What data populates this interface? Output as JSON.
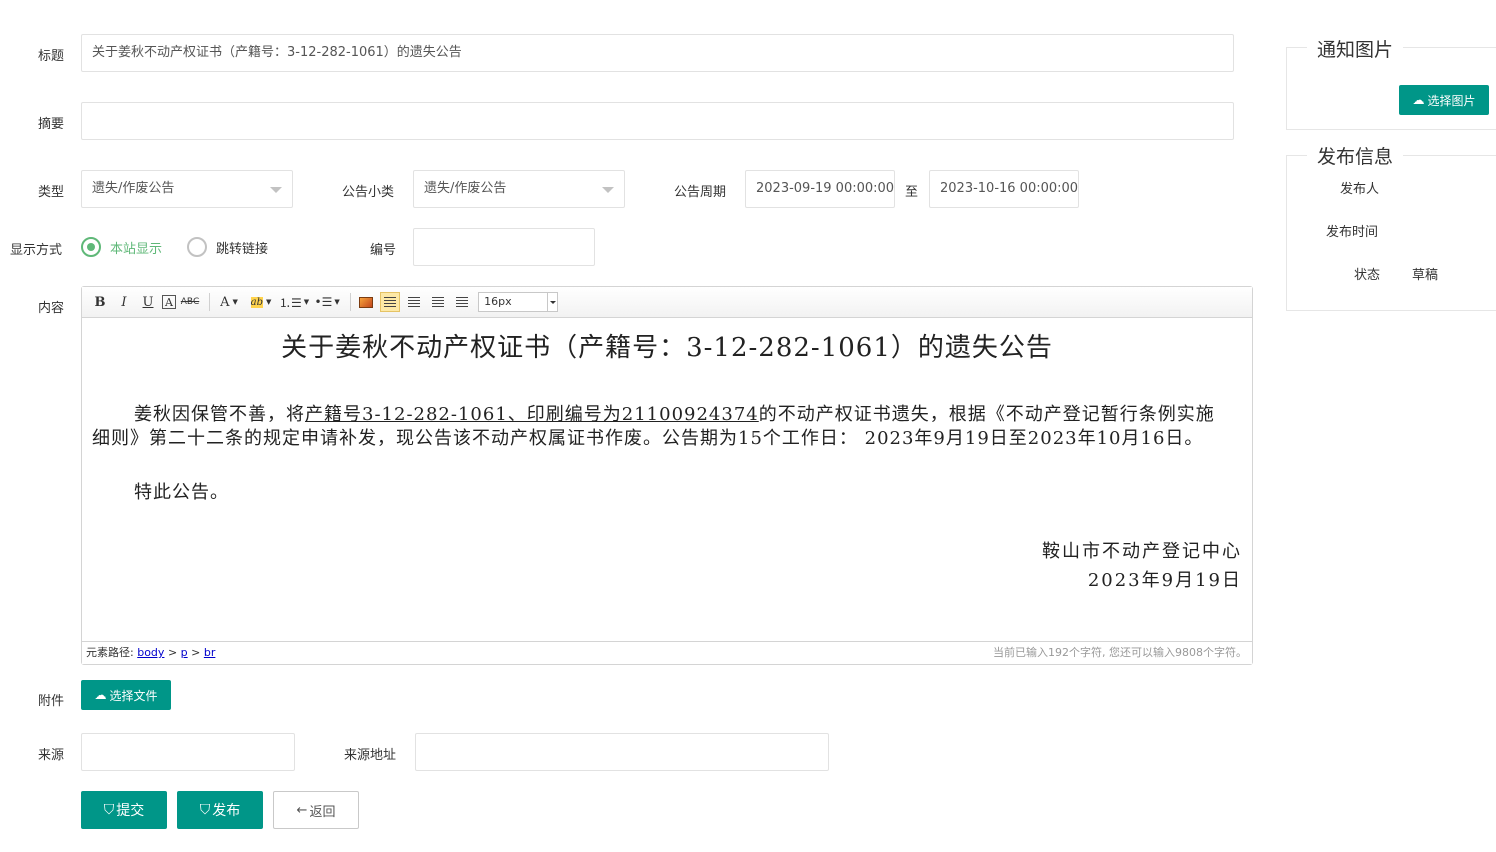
{
  "form": {
    "title_label": "标题",
    "title_value": "关于姜秋不动产权证书（产籍号：3-12-282-1061）的遗失公告",
    "summary_label": "摘要",
    "summary_value": "",
    "type_label": "类型",
    "type_value": "遗失/作废公告",
    "subtype_label": "公告小类",
    "subtype_value": "遗失/作废公告",
    "period_label": "公告周期",
    "period_start": "2023-09-19 00:00:00",
    "period_to": "至",
    "period_end": "2023-10-16 00:00:00",
    "display_label": "显示方式",
    "display_options": [
      "本站显示",
      "跳转链接"
    ],
    "number_label": "编号",
    "number_value": "",
    "content_label": "内容",
    "attachment_label": "附件",
    "choose_file": "选择文件",
    "source_label": "来源",
    "source_value": "",
    "source_url_label": "来源地址",
    "source_url_value": ""
  },
  "editor": {
    "toolbar": {
      "bold": "B",
      "italic": "I",
      "underline": "U",
      "fontcolor_box": "A",
      "strike": "ABC",
      "forecolor": "A",
      "highlight": "ab",
      "font_size": "16px"
    },
    "doc_title": "关于姜秋不动产权证书（产籍号：3-12-282-1061）的遗失公告",
    "para1_a": "姜秋因保管不善，将",
    "para1_u": "产籍号3-12-282-1061、印刷编号为21100924374",
    "para1_b": "的不动产权证书遗失，根据《不动产登记暂行条例实施细则》第二十二条的规定申请补发，现公告该不动产权属证书作废。公告期为15个工作日：  2023年9月19日至2023年10月16日。",
    "para2": "特此公告。",
    "sign_org": "鞍山市不动产登记中心",
    "sign_date": "2023年9月19日",
    "path_label": "元素路径:",
    "path_body": "body",
    "path_gt": ">",
    "path_p": "p",
    "path_br": "br",
    "char_count": "当前已输入192个字符, 您还可以输入9808个字符。"
  },
  "actions": {
    "submit": "提交",
    "publish": "发布",
    "back": "返回"
  },
  "sidebar": {
    "image_legend": "通知图片",
    "choose_image": "选择图片",
    "publish_legend": "发布信息",
    "publisher_label": "发布人",
    "publisher_value": "",
    "publish_time_label": "发布时间",
    "publish_time_value": "",
    "status_label": "状态",
    "status_value": "草稿"
  },
  "colors": {
    "teal": "#009688",
    "radio_green": "#5fb878",
    "border": "#e2e2e2"
  }
}
